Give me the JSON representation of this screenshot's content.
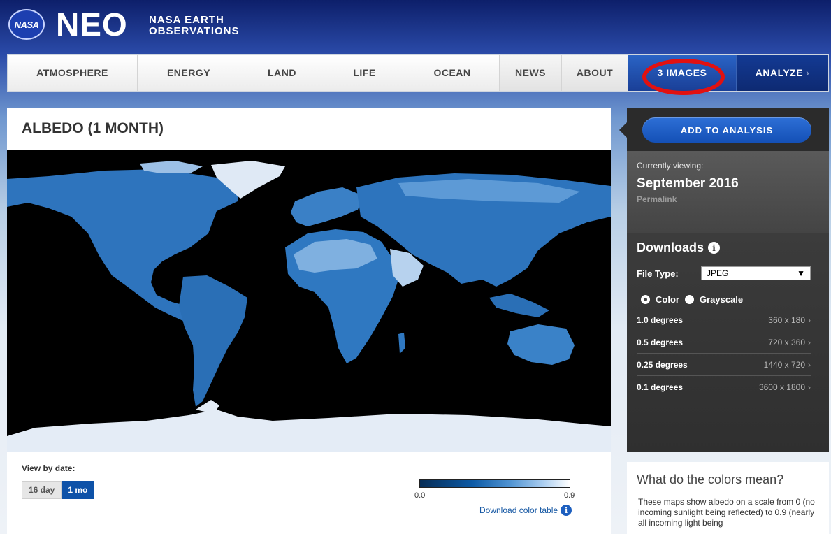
{
  "header": {
    "nasa_logo": "NASA",
    "title": "NEO",
    "subtitle_line1": "NASA EARTH",
    "subtitle_line2": "OBSERVATIONS"
  },
  "nav": {
    "items": [
      "ATMOSPHERE",
      "ENERGY",
      "LAND",
      "LIFE",
      "OCEAN",
      "NEWS",
      "ABOUT"
    ],
    "images_label": "3 IMAGES",
    "analyze_label": "ANALYZE",
    "analyze_arrow": "›"
  },
  "main": {
    "title": "ALBEDO (1 MONTH)",
    "view_label": "View by date:",
    "toggle": [
      "16 day",
      "1 mo"
    ],
    "selected_toggle": "1 mo",
    "scale_min": "0.0",
    "scale_max": "0.9",
    "download_color_table": "Download color table",
    "info_glyph": "i"
  },
  "side": {
    "add_button": "ADD TO ANALYSIS",
    "currently_viewing_label": "Currently viewing:",
    "current_date": "September 2016",
    "permalink": "Permalink",
    "downloads_title": "Downloads",
    "file_type_label": "File Type:",
    "file_type_value": "JPEG",
    "select_arrow": "▼",
    "radio_color": "Color",
    "radio_grayscale": "Grayscale",
    "selected_radio": "Color",
    "resolutions": [
      {
        "degrees": "1.0 degrees",
        "pixels": "360 x 180"
      },
      {
        "degrees": "0.5 degrees",
        "pixels": "720 x 360"
      },
      {
        "degrees": "0.25 degrees",
        "pixels": "1440 x 720"
      },
      {
        "degrees": "0.1 degrees",
        "pixels": "3600 x 1800"
      }
    ],
    "row_chevron": "›"
  },
  "colors_box": {
    "title": "What do the colors mean?",
    "text": "These maps show albedo on a scale from 0 (no incoming sunlight being reflected) to 0.9 (nearly all incoming light being"
  },
  "colors": {
    "nav_active": "#1a3f97",
    "toggle_active": "#0e52a8",
    "add_button": "#1450b6",
    "highlight_ring": "#e11111",
    "map_land": "#2f77c0",
    "map_ice": "#e4ecf6"
  }
}
